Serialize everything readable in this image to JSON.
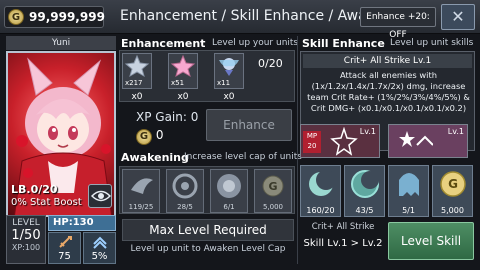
{
  "header": {
    "gold": "99,999,999",
    "title": "Enhancement / Skill Enhance / Awakening",
    "enhance_toggle": "Enhance +20: OFF",
    "close_icon": "close-icon"
  },
  "unit": {
    "name": "Yuni",
    "limit_break": "LB.0/20",
    "stat_boost": "0% Stat Boost",
    "level_label": "LEVEL",
    "level": "1/50",
    "xp": "XP:100",
    "hp": "HP:130",
    "atk": "75",
    "crit": "5%"
  },
  "enhancement": {
    "title": "Enhancement",
    "subtitle": "Level up your units",
    "count": "0/20",
    "materials": [
      {
        "count": "x217",
        "selected": "x0",
        "icon": "silver-star-icon"
      },
      {
        "count": "x51",
        "selected": "x0",
        "icon": "pink-star-icon"
      },
      {
        "count": "x11",
        "selected": "x0",
        "icon": "fairy-icon"
      }
    ],
    "xp_gain": "XP Gain: 0",
    "gold_cost": "0",
    "enhance_button": "Enhance"
  },
  "awakening": {
    "title": "Awakening",
    "subtitle": "Increase level cap of units",
    "slots": [
      {
        "count": "119/25",
        "icon": "wing-icon"
      },
      {
        "count": "28/5",
        "icon": "disc-icon"
      },
      {
        "count": "6/1",
        "icon": "orb-icon"
      },
      {
        "count": "5,000",
        "icon": "gold-coin-icon"
      }
    ],
    "max_level": "Max Level Required",
    "hint": "Level up unit to Awaken Level Cap"
  },
  "skill": {
    "title": "Skill Enhance",
    "subtitle": "Level up unit skills",
    "name": "Crit+ All Strike Lv.1",
    "description": "Attack all enemies with (1x/1.2x/1.4x/1.7x/2x) dmg, increase team Crit Rate+ (1%/2%/3%/4%/5%) & Crit DMG+ (x0.1/x0.1/x0.1/x0.1/x0.2)",
    "mp": "MP 20",
    "icon_left_lvl": "Lv.1",
    "icon_right_lvl": "Lv.1",
    "slots": [
      {
        "count": "160/20",
        "icon": "moon-icon"
      },
      {
        "count": "43/5",
        "icon": "moon-orb-icon"
      },
      {
        "count": "5/1",
        "icon": "ghost-icon"
      },
      {
        "count": "5,000",
        "icon": "gold-coin-icon"
      }
    ],
    "next_name": "Crit+ All Strike",
    "level_change": "Skill Lv.1 > Lv.2",
    "level_button": "Level Skill"
  },
  "colors": {
    "accent_green": "#3f7e55",
    "panel_bg": "#2a2e35",
    "hp_blue": "#3e6f95"
  }
}
